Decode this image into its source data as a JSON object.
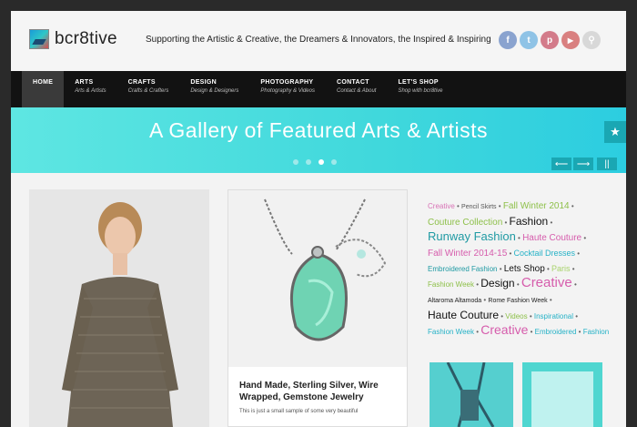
{
  "site": {
    "name": "bcr8tive",
    "tagline": "Supporting the Artistic & Creative, the Dreamers & Innovators, the Inspired & Inspiring"
  },
  "social": [
    {
      "name": "facebook-icon",
      "glyph": "f"
    },
    {
      "name": "twitter-icon",
      "glyph": "t"
    },
    {
      "name": "pinterest-icon",
      "glyph": "p"
    },
    {
      "name": "youtube-icon",
      "glyph": "▶"
    },
    {
      "name": "search-icon",
      "glyph": "⚲"
    }
  ],
  "nav": [
    {
      "title": "HOME",
      "sub": ""
    },
    {
      "title": "ARTS",
      "sub": "Arts & Artists"
    },
    {
      "title": "CRAFTS",
      "sub": "Crafts & Crafters"
    },
    {
      "title": "DESIGN",
      "sub": "Design & Designers"
    },
    {
      "title": "PHOTOGRAPHY",
      "sub": "Photography & Videos"
    },
    {
      "title": "CONTACT",
      "sub": "Contact & About"
    },
    {
      "title": "LET'S SHOP",
      "sub": "Shop with bcr8tive"
    }
  ],
  "banner": {
    "title": "A Gallery of Featured Arts & Artists",
    "prev": "⟵",
    "next": "⟶",
    "pause": "||",
    "star": "★"
  },
  "post": {
    "title": "Hand Made, Sterling Silver, Wire Wrapped, Gemstone Jewelry",
    "excerpt": "This is just a small sample of some very beautiful"
  },
  "tags": [
    {
      "text": "Creative",
      "color": "#d873b6",
      "size": 8
    },
    {
      "text": "Pencil Skirts",
      "color": "#555555",
      "size": 7
    },
    {
      "text": "Fall Winter 2014",
      "color": "#8ec04a",
      "size": 10
    },
    {
      "text": "Couture Collection",
      "color": "#8ec04a",
      "size": 10
    },
    {
      "text": "Fashion",
      "color": "#111111",
      "size": 12
    },
    {
      "text": "Runway Fashion",
      "color": "#1f9aa3",
      "size": 13
    },
    {
      "text": "Haute Couture",
      "color": "#d65cac",
      "size": 10
    },
    {
      "text": "Fall Winter 2014-15",
      "color": "#d65cac",
      "size": 10
    },
    {
      "text": "Cocktail Dresses",
      "color": "#26b2c7",
      "size": 9
    },
    {
      "text": "Embroidered Fashion",
      "color": "#1f9aa3",
      "size": 8
    },
    {
      "text": "Lets Shop",
      "color": "#111111",
      "size": 10
    },
    {
      "text": "Paris",
      "color": "#a8d36b",
      "size": 9
    },
    {
      "text": "Fashion Week",
      "color": "#8ec04a",
      "size": 8
    },
    {
      "text": "Design",
      "color": "#111111",
      "size": 12
    },
    {
      "text": "Creative",
      "color": "#d65cac",
      "size": 15
    },
    {
      "text": "Altaroma Altamoda",
      "color": "#222222",
      "size": 7
    },
    {
      "text": "Rome Fashion Week",
      "color": "#222222",
      "size": 7
    },
    {
      "text": "Haute Couture",
      "color": "#111111",
      "size": 12
    },
    {
      "text": "Videos",
      "color": "#8ec04a",
      "size": 8
    },
    {
      "text": "Inspirational",
      "color": "#26b2c7",
      "size": 8
    },
    {
      "text": "Fashion Week",
      "color": "#26b2c7",
      "size": 8
    },
    {
      "text": "Creative",
      "color": "#d65cac",
      "size": 14
    },
    {
      "text": "Embroidered",
      "color": "#26b2c7",
      "size": 8
    },
    {
      "text": "Fashion",
      "color": "#26b2c7",
      "size": 8
    }
  ]
}
